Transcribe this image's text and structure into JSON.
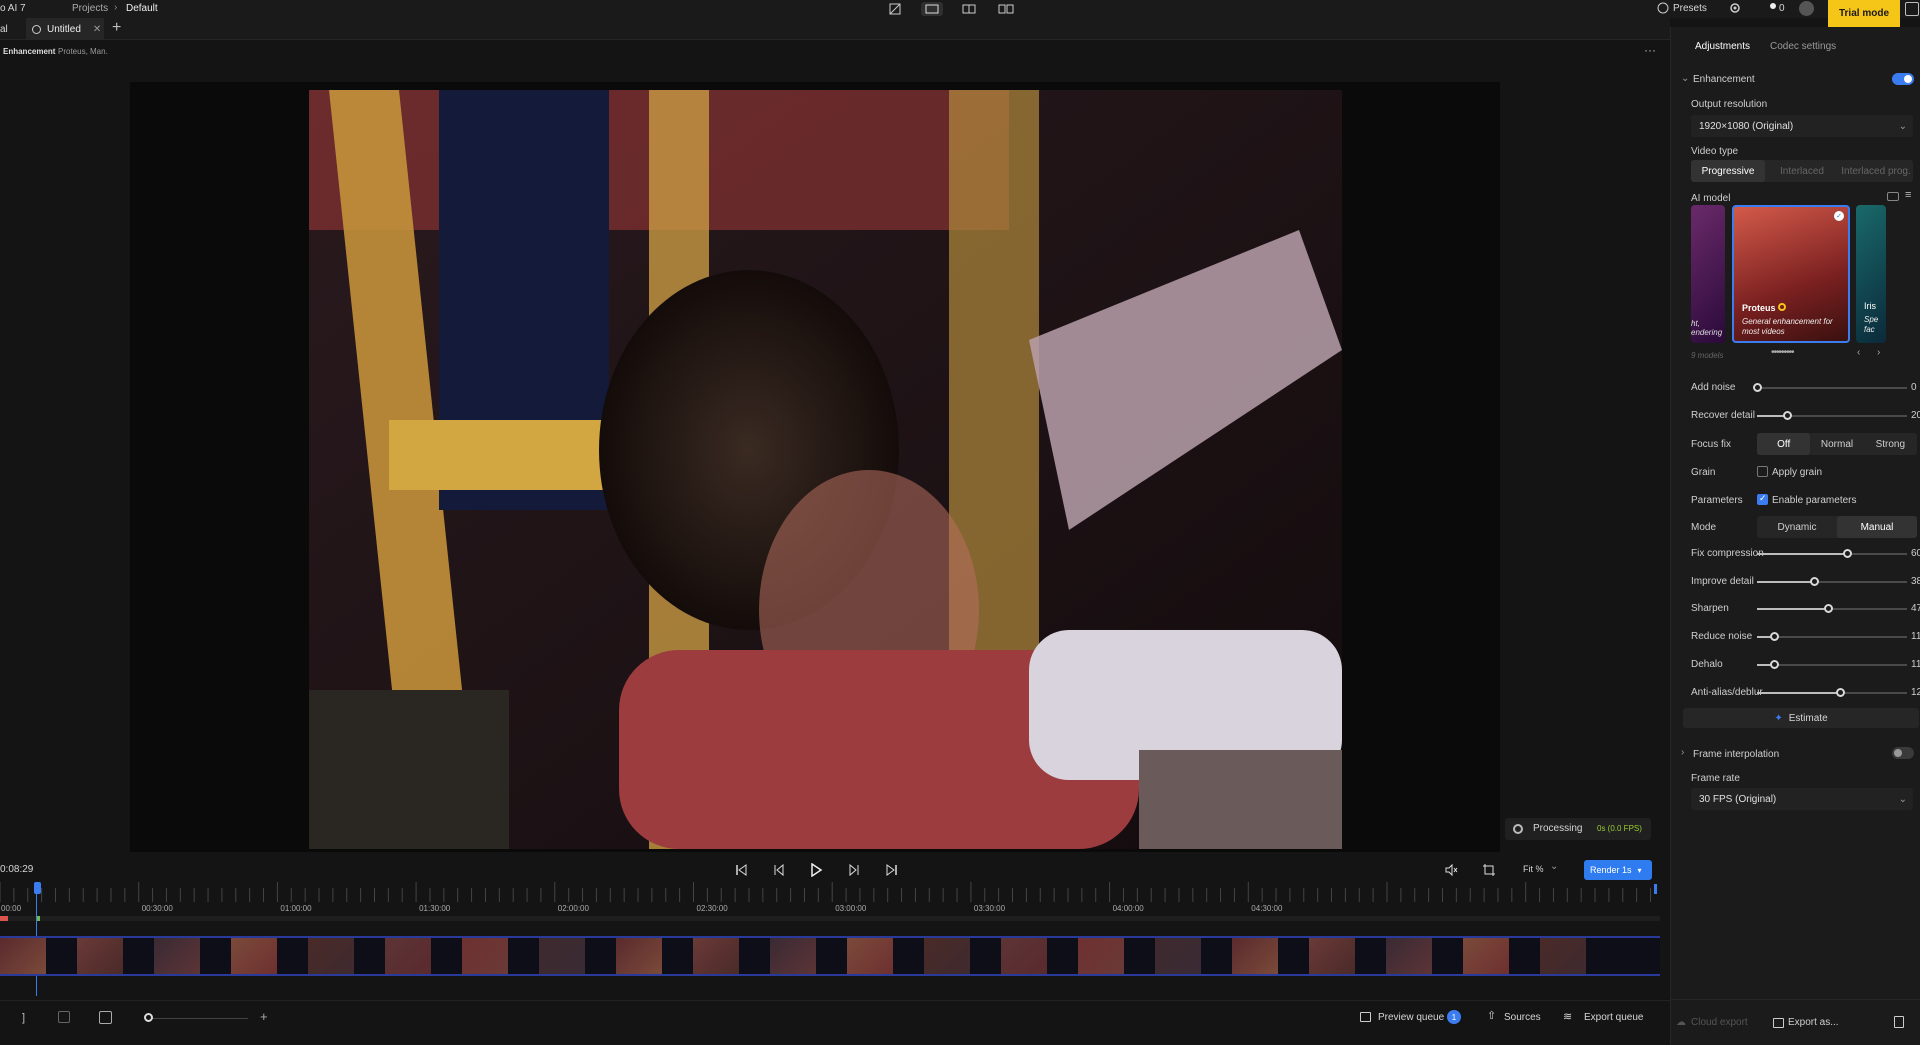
{
  "app": {
    "title": "o AI 7",
    "breadcrumb": [
      "Projects",
      "Default"
    ],
    "presets_label": "Presets",
    "notif_count": "0",
    "trial_label": "Trial mode"
  },
  "tabs": [
    {
      "label": "al"
    },
    {
      "label": "Untitled"
    }
  ],
  "info": {
    "enhancement_label": "Enhancement",
    "enhancement_detail": "Proteus, Man."
  },
  "processing": {
    "label": "Processing",
    "fps": "0s (0.0 FPS)"
  },
  "playback": {
    "timecode": "0:08:29",
    "fit_label": "Fit %",
    "render_label": "Render 1s"
  },
  "timeline": {
    "ticks": [
      "00:00",
      "00:30:00",
      "01:00:00",
      "01:30:00",
      "02:00:00",
      "02:30:00",
      "03:00:00",
      "03:30:00",
      "04:00:00",
      "04:30:00"
    ]
  },
  "bottombar": {
    "preview_queue": "Preview queue",
    "preview_count": "1",
    "sources": "Sources",
    "export_queue": "Export queue",
    "cloud_export": "Cloud export",
    "export_as": "Export as..."
  },
  "panel": {
    "tabs": [
      "Adjustments",
      "Codec settings"
    ],
    "enhancement_title": "Enhancement",
    "output_resolution_label": "Output resolution",
    "output_resolution_value": "1920×1080 (Original)",
    "video_type_label": "Video type",
    "video_types": [
      "Progressive",
      "Interlaced",
      "Interlaced prog."
    ],
    "ai_model_label": "AI model",
    "models": [
      {
        "name": "",
        "desc": "ht, endering"
      },
      {
        "name": "Proteus",
        "desc": "General enhancement for most videos"
      },
      {
        "name": "Iris",
        "desc": "Spe fac"
      }
    ],
    "models_count": "9 models",
    "sliders": [
      {
        "label": "Add noise",
        "value": "0",
        "pct": 0
      },
      {
        "label": "Recover detail",
        "value": "20",
        "pct": 0.2
      }
    ],
    "focus_fix_label": "Focus fix",
    "focus_fix_options": [
      "Off",
      "Normal",
      "Strong"
    ],
    "grain_label": "Grain",
    "grain_check": "Apply grain",
    "parameters_label": "Parameters",
    "parameters_check": "Enable parameters",
    "mode_label": "Mode",
    "mode_options": [
      "Dynamic",
      "Manual"
    ],
    "param_sliders": [
      {
        "label": "Fix compression",
        "value": "60",
        "pct": 0.6
      },
      {
        "label": "Improve detail",
        "value": "38",
        "pct": 0.38
      },
      {
        "label": "Sharpen",
        "value": "47",
        "pct": 0.47
      },
      {
        "label": "Reduce noise",
        "value": "11",
        "pct": 0.11
      },
      {
        "label": "Dehalo",
        "value": "11",
        "pct": 0.11
      },
      {
        "label": "Anti-alias/deblur",
        "value": "12",
        "pct": 0.55
      }
    ],
    "estimate_label": "Estimate",
    "frame_interp_label": "Frame interpolation",
    "frame_rate_label": "Frame rate",
    "frame_rate_value": "30 FPS (Original)"
  },
  "colors": {
    "accent": "#3b7df0",
    "trial": "#f5c518",
    "fps_green": "#9acd32"
  }
}
